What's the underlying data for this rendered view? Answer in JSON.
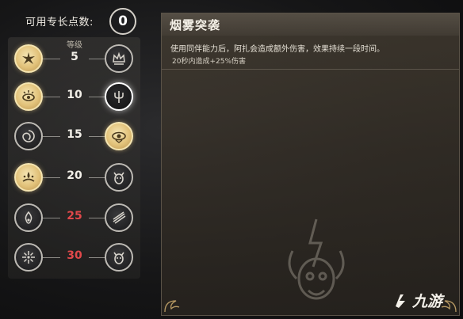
{
  "points": {
    "label": "可用专长点数:",
    "value": "0"
  },
  "tree": {
    "level_header": "等级",
    "rows": [
      {
        "level": "5",
        "locked": false,
        "left": {
          "icon": "burst-icon",
          "state": "active"
        },
        "right": {
          "icon": "crown-icon",
          "state": "inactive"
        }
      },
      {
        "level": "10",
        "locked": false,
        "left": {
          "icon": "eye-burst-icon",
          "state": "active"
        },
        "right": {
          "icon": "pitchfork-icon",
          "state": "selected"
        }
      },
      {
        "level": "15",
        "locked": false,
        "left": {
          "icon": "whirl-icon",
          "state": "inactive"
        },
        "right": {
          "icon": "eye-icon",
          "state": "active"
        }
      },
      {
        "level": "20",
        "locked": false,
        "left": {
          "icon": "splash-icon",
          "state": "active"
        },
        "right": {
          "icon": "creature-icon",
          "state": "inactive"
        }
      },
      {
        "level": "25",
        "locked": true,
        "left": {
          "icon": "fire-icon",
          "state": "inactive"
        },
        "right": {
          "icon": "claw-icon",
          "state": "inactive"
        }
      },
      {
        "level": "30",
        "locked": true,
        "left": {
          "icon": "spark-icon",
          "state": "inactive"
        },
        "right": {
          "icon": "creature-icon",
          "state": "inactive"
        }
      }
    ]
  },
  "detail": {
    "title": "烟雾突袭",
    "description": "使用同伴能力后，阿扎会造成额外伤害，效果持续一段时间。",
    "effect": "20秒内造成+25%伤害"
  },
  "watermark": {
    "text": "九游"
  },
  "colors": {
    "active_gold": "#e2c27a",
    "locked_red": "#e0484a"
  }
}
